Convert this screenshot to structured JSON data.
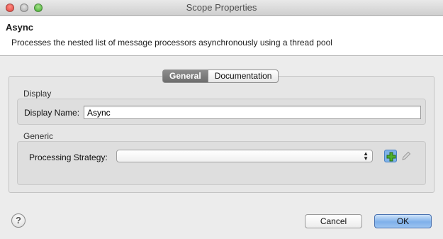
{
  "window": {
    "title": "Scope Properties"
  },
  "header": {
    "title": "Async",
    "description": "Processes the nested list of message processors asynchronously using a thread pool"
  },
  "tabs": [
    {
      "label": "General",
      "active": true
    },
    {
      "label": "Documentation",
      "active": false
    }
  ],
  "display": {
    "group_label": "Display",
    "name_label": "Display Name:",
    "name_value": "Async"
  },
  "generic": {
    "group_label": "Generic",
    "strategy_label": "Processing Strategy:",
    "strategy_value": ""
  },
  "footer": {
    "help_glyph": "?",
    "cancel_label": "Cancel",
    "ok_label": "OK"
  },
  "colors": {
    "accent": "#7fb0ea",
    "add_icon": "#3c9a1f",
    "active_tab": "#7a7a7a"
  }
}
